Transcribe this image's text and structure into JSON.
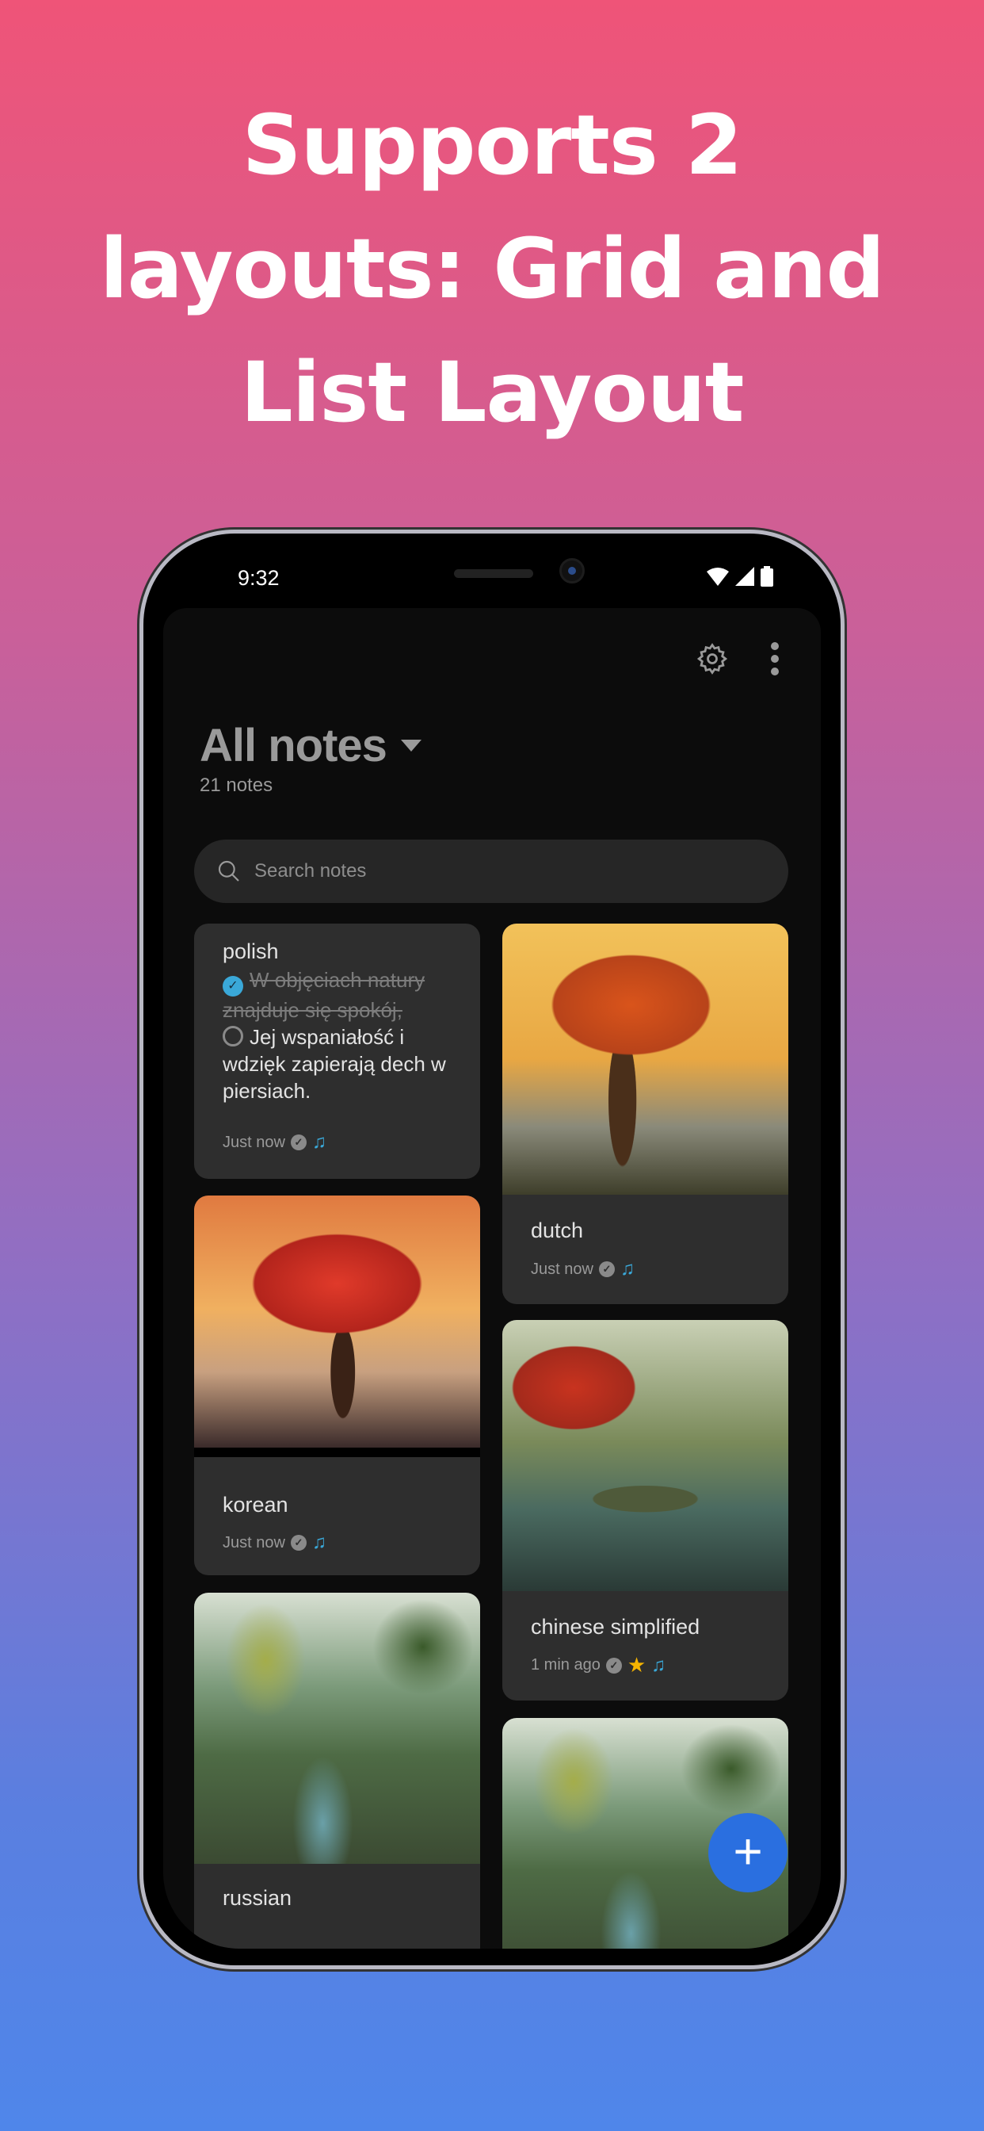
{
  "headline": [
    "Supports 2",
    "layouts: Grid and",
    "List Layout"
  ],
  "status": {
    "time": "9:32"
  },
  "toolbar": {
    "settings_icon": "gear-icon",
    "menu_icon": "more-vert-icon"
  },
  "header": {
    "title": "All notes",
    "count": "21 notes"
  },
  "search": {
    "placeholder": "Search notes"
  },
  "colors": {
    "accent": "#2a6fe0",
    "check": "#3aa8d8",
    "star": "#f5b400",
    "music": "#3aa8d8"
  },
  "notes": [
    {
      "title": "polish",
      "checklist": [
        {
          "text": "W objęciach natury znajduje się spokój,",
          "checked": true
        },
        {
          "text": "Jej wspaniałość i wdzięk zapierają dech w piersiach.",
          "checked": false
        }
      ],
      "time": "Just now"
    },
    {
      "title": "dutch",
      "time": "Just now"
    },
    {
      "title": "korean",
      "time": "Just now"
    },
    {
      "title": "chinese simplified",
      "time": "1 min ago",
      "starred": true
    },
    {
      "title": "russian"
    },
    {
      "title": ""
    }
  ],
  "fab": {
    "label": "+"
  }
}
